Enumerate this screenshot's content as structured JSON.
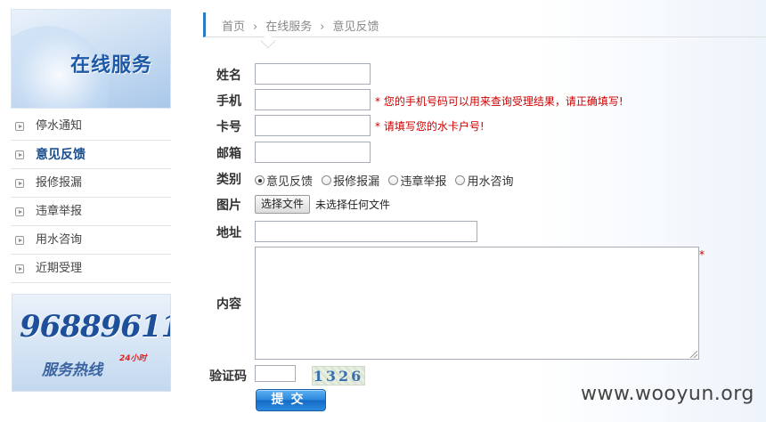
{
  "sidebar": {
    "banner_title": "在线服务",
    "items": [
      {
        "label": "停水通知",
        "active": false
      },
      {
        "label": "意见反馈",
        "active": true
      },
      {
        "label": "报修报漏",
        "active": false
      },
      {
        "label": "违章举报",
        "active": false
      },
      {
        "label": "用水咨询",
        "active": false
      },
      {
        "label": "近期受理",
        "active": false
      }
    ],
    "hotline": {
      "number": "96889611",
      "label": "服务热线",
      "hours": "24小时"
    }
  },
  "breadcrumb": [
    "首页",
    "在线服务",
    "意见反馈"
  ],
  "form": {
    "name_label": "姓名",
    "phone_label": "手机",
    "phone_hint": "* 您的手机号码可以用来查询受理结果，请正确填写!",
    "card_label": "卡号",
    "card_hint": "* 请填写您的水卡户号!",
    "email_label": "邮箱",
    "category_label": "类别",
    "category_options": [
      {
        "label": "意见反馈",
        "checked": true
      },
      {
        "label": "报修报漏",
        "checked": false
      },
      {
        "label": "违章举报",
        "checked": false
      },
      {
        "label": "用水咨询",
        "checked": false
      }
    ],
    "image_label": "图片",
    "file_button": "选择文件",
    "file_status": "未选择任何文件",
    "address_label": "地址",
    "content_label": "内容",
    "content_required": "*",
    "captcha_label": "验证码",
    "captcha_value": "1326",
    "submit_label": "提交"
  },
  "watermark": "www.wooyun.org"
}
